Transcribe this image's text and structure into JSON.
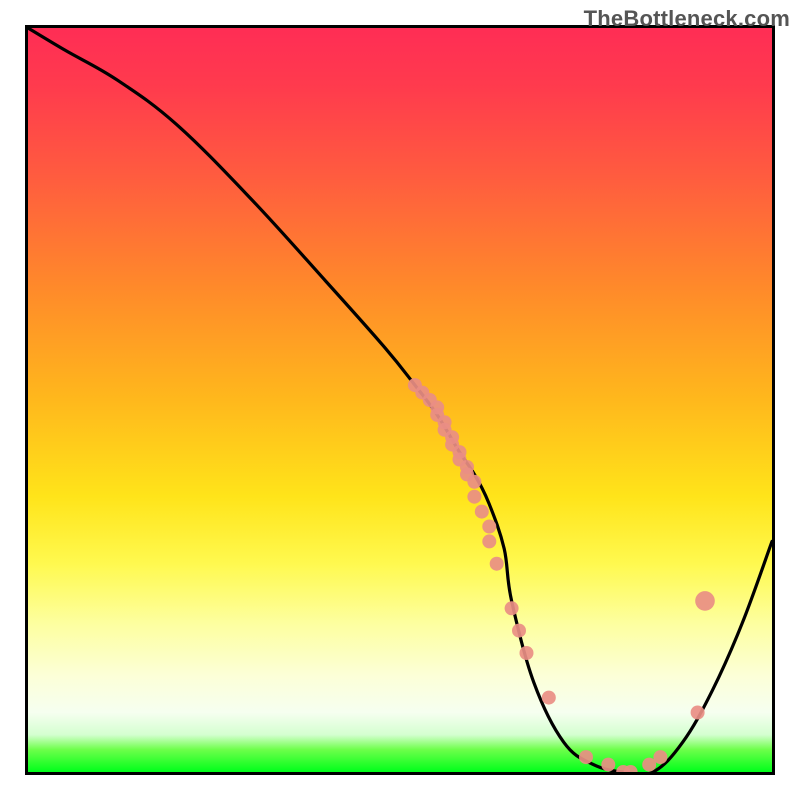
{
  "watermark": "TheBottleneck.com",
  "chart_data": {
    "type": "line",
    "title": "",
    "xlabel": "",
    "ylabel": "",
    "xlim": [
      0,
      100
    ],
    "ylim": [
      0,
      100
    ],
    "curve": {
      "name": "bottleneck-curve",
      "x": [
        0,
        5,
        12,
        20,
        30,
        40,
        48,
        52,
        55,
        58,
        60,
        62,
        64,
        65,
        68,
        72,
        76,
        80,
        84,
        88,
        92,
        96,
        100
      ],
      "y": [
        100,
        97,
        93,
        87,
        77,
        66,
        57,
        52,
        48,
        43,
        40,
        36,
        30,
        23,
        12,
        4,
        1,
        0,
        0,
        4,
        11,
        20,
        31
      ]
    },
    "scatter": {
      "name": "highlighted-points",
      "color": "#e98e84",
      "radius_px": 7,
      "x": [
        52,
        53,
        54,
        55,
        55,
        56,
        56,
        57,
        57,
        58,
        58,
        59,
        59,
        60,
        60,
        61,
        62,
        62,
        63,
        65,
        66,
        67,
        70,
        75,
        78,
        80,
        81,
        83.5,
        85,
        90,
        91
      ],
      "y": [
        52,
        51,
        50,
        49,
        48,
        47,
        46,
        45,
        44,
        43,
        42,
        41,
        40,
        39,
        37,
        35,
        33,
        31,
        28,
        22,
        19,
        16,
        10,
        2,
        1,
        0,
        0,
        1,
        2,
        8,
        23
      ],
      "radii": [
        1,
        1,
        1,
        1,
        1,
        1,
        1,
        1,
        1,
        1,
        1,
        1,
        1,
        1,
        1,
        1,
        1,
        1,
        1,
        1,
        1,
        1,
        1,
        1,
        1,
        1,
        1,
        1,
        1,
        1,
        1.4
      ]
    },
    "gradient_stops": [
      {
        "pos": 0,
        "color": "#ff2d55"
      },
      {
        "pos": 50,
        "color": "#ffb81c"
      },
      {
        "pos": 75,
        "color": "#fff94f"
      },
      {
        "pos": 95,
        "color": "#d4ffd0"
      },
      {
        "pos": 100,
        "color": "#00ff1a"
      }
    ]
  }
}
